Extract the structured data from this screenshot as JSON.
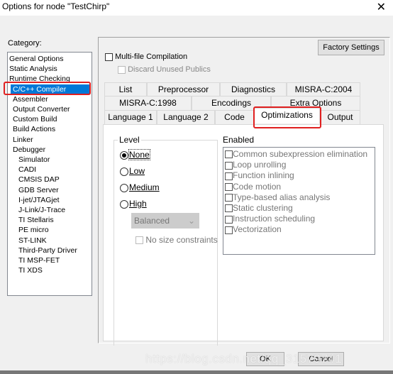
{
  "window": {
    "title": "Options for node \"TestChirp\"",
    "close_icon": "close-icon"
  },
  "category": {
    "label": "Category:",
    "items": [
      {
        "label": "General Options",
        "indent": 0
      },
      {
        "label": "Static Analysis",
        "indent": 0
      },
      {
        "label": "Runtime Checking",
        "indent": 0
      },
      {
        "label": "C/C++ Compiler",
        "indent": 1,
        "selected": true
      },
      {
        "label": "Assembler",
        "indent": 1
      },
      {
        "label": "Output Converter",
        "indent": 1
      },
      {
        "label": "Custom Build",
        "indent": 1
      },
      {
        "label": "Build Actions",
        "indent": 1
      },
      {
        "label": "Linker",
        "indent": 1
      },
      {
        "label": "Debugger",
        "indent": 1
      },
      {
        "label": "Simulator",
        "indent": 2
      },
      {
        "label": "CADI",
        "indent": 2
      },
      {
        "label": "CMSIS DAP",
        "indent": 2
      },
      {
        "label": "GDB Server",
        "indent": 2
      },
      {
        "label": "I-jet/JTAGjet",
        "indent": 2
      },
      {
        "label": "J-Link/J-Trace",
        "indent": 2
      },
      {
        "label": "TI Stellaris",
        "indent": 2
      },
      {
        "label": "PE micro",
        "indent": 2
      },
      {
        "label": "ST-LINK",
        "indent": 2
      },
      {
        "label": "Third-Party Driver",
        "indent": 2
      },
      {
        "label": "TI MSP-FET",
        "indent": 2
      },
      {
        "label": "TI XDS",
        "indent": 2
      }
    ]
  },
  "panel": {
    "factory_settings": "Factory Settings",
    "multifile": {
      "label": "Multi-file Compilation",
      "checked": false
    },
    "discard": {
      "label": "Discard Unused Publics",
      "checked": false,
      "disabled": true
    },
    "tabs": {
      "row1": [
        "List",
        "Preprocessor",
        "Diagnostics",
        "MISRA-C:2004"
      ],
      "row2": [
        "MISRA-C:1998",
        "Encodings",
        "Extra Options"
      ],
      "row3": [
        "Language 1",
        "Language 2",
        "Code",
        "Optimizations",
        "Output"
      ],
      "selected": "Optimizations"
    },
    "level": {
      "label": "Level",
      "options": [
        "None",
        "Low",
        "Medium",
        "High"
      ],
      "selected": "None",
      "high_mode": "Balanced",
      "no_size": "No size constraints"
    },
    "enabled": {
      "label": "Enabled",
      "items": [
        "Common subexpression elimination",
        "Loop unrolling",
        "Function inlining",
        "Code motion",
        "Type-based alias analysis",
        "Static clustering",
        "Instruction scheduling",
        "Vectorization"
      ]
    }
  },
  "buttons": {
    "ok": "OK",
    "cancel": "Cancel"
  },
  "watermark": "https://blog.csdn.net/qq_31579741",
  "colors": {
    "selection": "#0078d7",
    "highlight_box": "#e02020"
  }
}
